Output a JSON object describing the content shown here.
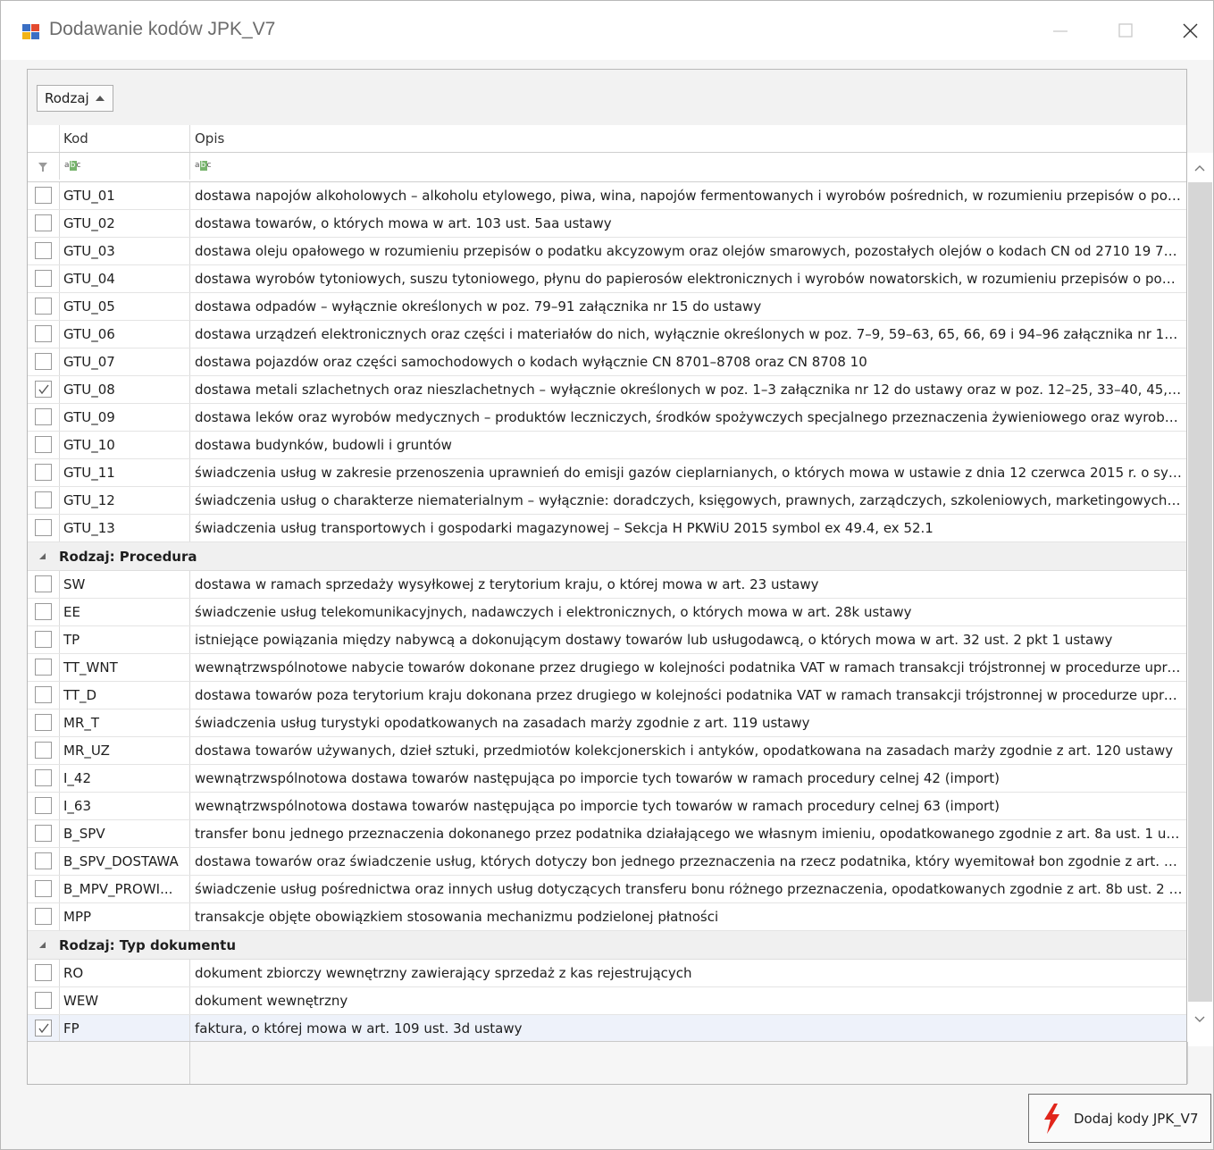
{
  "window": {
    "title": "Dodawanie kodów JPK_V7"
  },
  "groupbar": {
    "chip_label": "Rodzaj"
  },
  "columns": {
    "kod": "Kod",
    "opis": "Opis"
  },
  "groups": [
    {
      "label": "",
      "rows": [
        {
          "kod": "GTU_01",
          "opis": "dostawa napojów alkoholowych – alkoholu etylowego, piwa, wina, napojów fermentowanych i wyrobów pośrednich, w rozumieniu przepisów o poda...",
          "checked": false
        },
        {
          "kod": "GTU_02",
          "opis": "dostawa towarów, o których mowa w art. 103 ust. 5aa ustawy",
          "checked": false
        },
        {
          "kod": "GTU_03",
          "opis": "dostawa oleju opałowego w rozumieniu przepisów o podatku akcyzowym oraz olejów smarowych, pozostałych olejów o kodach CN od 2710 19 71 d...",
          "checked": false
        },
        {
          "kod": "GTU_04",
          "opis": "dostawa wyrobów tytoniowych, suszu tytoniowego, płynu do papierosów elektronicznych i wyrobów nowatorskich, w rozumieniu przepisów o podat...",
          "checked": false
        },
        {
          "kod": "GTU_05",
          "opis": "dostawa odpadów – wyłącznie określonych w poz. 79–91 załącznika nr 15 do ustawy",
          "checked": false
        },
        {
          "kod": "GTU_06",
          "opis": "dostawa urządzeń elektronicznych oraz części i materiałów do nich, wyłącznie określonych w poz. 7–9, 59–63, 65, 66, 69 i 94–96 załącznika nr 15 d...",
          "checked": false
        },
        {
          "kod": "GTU_07",
          "opis": "dostawa pojazdów oraz części samochodowych o kodach wyłącznie CN 8701–8708 oraz CN 8708 10",
          "checked": false
        },
        {
          "kod": "GTU_08",
          "opis": "dostawa metali szlachetnych oraz nieszlachetnych – wyłącznie określonych w poz. 1–3 załącznika nr 12 do ustawy oraz w poz. 12–25, 33–40, 45, 4...",
          "checked": true
        },
        {
          "kod": "GTU_09",
          "opis": "dostawa leków oraz wyrobów medycznych – produktów leczniczych, środków spożywczych specjalnego przeznaczenia żywieniowego oraz wyrobów...",
          "checked": false
        },
        {
          "kod": "GTU_10",
          "opis": "dostawa budynków, budowli i gruntów",
          "checked": false
        },
        {
          "kod": "GTU_11",
          "opis": "świadczenia usług w zakresie przenoszenia uprawnień do emisji gazów cieplarnianych, o których mowa w ustawie z dnia 12 czerwca 2015 r. o syste...",
          "checked": false
        },
        {
          "kod": "GTU_12",
          "opis": "świadczenia usług o charakterze niematerialnym – wyłącznie: doradczych, księgowych, prawnych, zarządczych, szkoleniowych, marketingowych, fi...",
          "checked": false
        },
        {
          "kod": "GTU_13",
          "opis": "świadczenia usług transportowych i gospodarki magazynowej – Sekcja H PKWiU 2015 symbol ex 49.4, ex 52.1",
          "checked": false
        }
      ]
    },
    {
      "label": "Rodzaj: Procedura",
      "rows": [
        {
          "kod": "SW",
          "opis": "dostawa w ramach sprzedaży wysyłkowej z terytorium kraju, o której mowa w art. 23 ustawy",
          "checked": false
        },
        {
          "kod": "EE",
          "opis": "świadczenie usług telekomunikacyjnych, nadawczych i elektronicznych, o których mowa w art. 28k ustawy",
          "checked": false
        },
        {
          "kod": "TP",
          "opis": "istniejące powiązania między nabywcą a dokonującym dostawy towarów lub usługodawcą, o których mowa w art. 32 ust. 2 pkt 1 ustawy",
          "checked": false
        },
        {
          "kod": "TT_WNT",
          "opis": "wewnątrzwspólnotowe nabycie towarów dokonane przez drugiego w kolejności podatnika VAT w ramach transakcji trójstronnej w procedurze upros...",
          "checked": false
        },
        {
          "kod": "TT_D",
          "opis": "dostawa towarów poza terytorium kraju dokonana przez drugiego w kolejności podatnika VAT w ramach transakcji trójstronnej w procedurze uprosz...",
          "checked": false
        },
        {
          "kod": "MR_T",
          "opis": "świadczenia usług turystyki opodatkowanych na zasadach marży zgodnie z art. 119 ustawy",
          "checked": false
        },
        {
          "kod": "MR_UZ",
          "opis": "dostawa towarów używanych, dzieł sztuki, przedmiotów kolekcjonerskich i antyków, opodatkowana na zasadach marży zgodnie z art. 120 ustawy",
          "checked": false
        },
        {
          "kod": "I_42",
          "opis": "wewnątrzwspólnotowa dostawa towarów następująca po imporcie tych towarów w ramach procedury celnej 42 (import)",
          "checked": false
        },
        {
          "kod": "I_63",
          "opis": "wewnątrzwspólnotowa dostawa towarów następująca po imporcie tych towarów w ramach procedury celnej 63 (import)",
          "checked": false
        },
        {
          "kod": "B_SPV",
          "opis": "transfer bonu jednego przeznaczenia dokonanego przez podatnika działającego we własnym imieniu, opodatkowanego zgodnie z art. 8a ust. 1 usta...",
          "checked": false
        },
        {
          "kod": "B_SPV_DOSTAWA",
          "opis": "dostawa towarów oraz świadczenie usług, których dotyczy bon jednego przeznaczenia na rzecz podatnika, który wyemitował bon zgodnie z art. 8a ...",
          "checked": false
        },
        {
          "kod": "B_MPV_PROWI...",
          "opis": "świadczenie usług pośrednictwa oraz innych usług dotyczących transferu bonu różnego przeznaczenia, opodatkowanych zgodnie z art. 8b ust. 2 us...",
          "checked": false
        },
        {
          "kod": "MPP",
          "opis": "transakcje objęte obowiązkiem stosowania mechanizmu podzielonej płatności",
          "checked": false
        }
      ]
    },
    {
      "label": "Rodzaj: Typ dokumentu",
      "rows": [
        {
          "kod": "RO",
          "opis": "dokument zbiorczy wewnętrzny zawierający sprzedaż z kas rejestrujących",
          "checked": false
        },
        {
          "kod": "WEW",
          "opis": "dokument wewnętrzny",
          "checked": false
        },
        {
          "kod": "FP",
          "opis": "faktura, o której mowa w art. 109 ust. 3d ustawy",
          "checked": true,
          "selected": true
        }
      ]
    }
  ],
  "action_button": {
    "label": "Dodaj kody JPK_V7",
    "icon": "lightning-bolt-icon"
  },
  "colors": {
    "check": "#555555",
    "bolt": "#e1251b",
    "selection": "#eef2fa"
  }
}
